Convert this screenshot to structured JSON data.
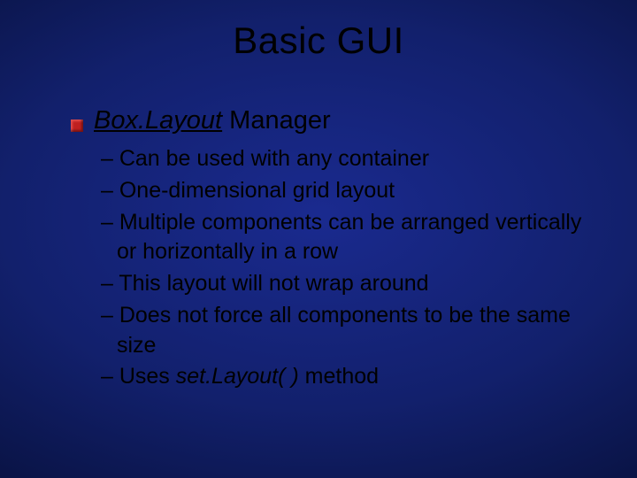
{
  "title": "Basic GUI",
  "main_bullet": {
    "class_name": "Box.Layout",
    "suffix": " Manager"
  },
  "sub_items": {
    "i0": "– Can be used with any container",
    "i1": "– One-dimensional grid layout",
    "i2": "– Multiple components can be arranged vertically or horizontally in a row",
    "i3": "– This layout will not wrap around",
    "i4": "– Does not force all components to be the same size",
    "i5_prefix": "– Uses ",
    "i5_method": "set.Layout( )",
    "i5_suffix": " method"
  }
}
